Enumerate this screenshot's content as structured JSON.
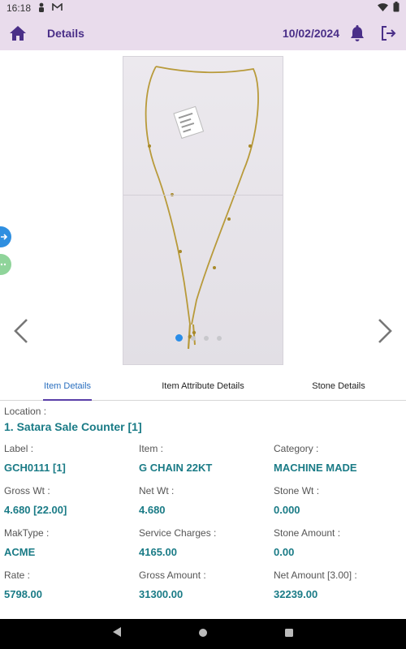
{
  "status": {
    "time": "16:18"
  },
  "app_bar": {
    "title": "Details",
    "date": "10/02/2024"
  },
  "gallery": {
    "dots": 4,
    "active_dot": 0
  },
  "tabs": [
    "Item Details",
    "Item Attribute Details",
    "Stone Details"
  ],
  "location": {
    "label": "Location :",
    "value": "1. Satara Sale Counter [1]"
  },
  "fields": [
    {
      "label": "Label :",
      "value": "GCH0111 [1]"
    },
    {
      "label": "Item :",
      "value": "G CHAIN 22KT"
    },
    {
      "label": "Category :",
      "value": "MACHINE MADE"
    },
    {
      "label": "Gross Wt :",
      "value": "4.680 [22.00]"
    },
    {
      "label": "Net Wt :",
      "value": "4.680"
    },
    {
      "label": "Stone Wt :",
      "value": "0.000"
    },
    {
      "label": "MakType :",
      "value": "ACME"
    },
    {
      "label": "Service Charges :",
      "value": "4165.00"
    },
    {
      "label": "Stone Amount :",
      "value": "0.00"
    },
    {
      "label": "Rate :",
      "value": "5798.00"
    },
    {
      "label": "Gross Amount :",
      "value": "31300.00"
    },
    {
      "label": "Net Amount  [3.00] :",
      "value": "32239.00"
    }
  ],
  "colors": {
    "accent": "#4a2f88",
    "value_text": "#1a7b86",
    "app_bar_bg": "#e9dcec",
    "active_dot": "#2a8de8"
  },
  "icons": [
    "person-icon",
    "gmail-icon",
    "wifi-icon",
    "battery-icon",
    "home-icon",
    "bell-icon",
    "logout-icon",
    "chevron-left-icon",
    "chevron-right-icon",
    "back-nav-icon",
    "home-nav-icon",
    "recents-nav-icon"
  ]
}
